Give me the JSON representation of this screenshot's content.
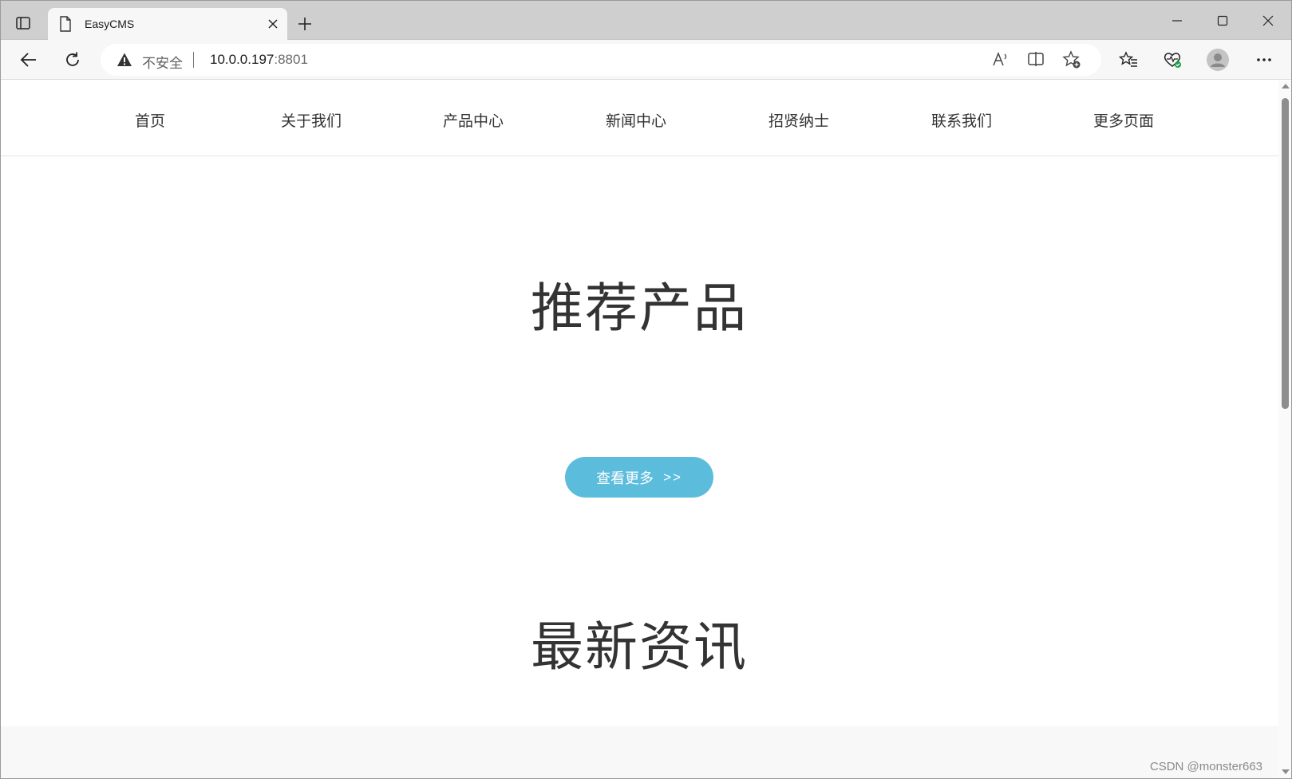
{
  "browser": {
    "tab": {
      "title": "EasyCMS"
    },
    "address_bar": {
      "security_label": "不安全",
      "url_host": "10.0.0.197",
      "url_port": ":8801"
    },
    "icons": {
      "read_aloud": "A⁾"
    }
  },
  "site": {
    "nav": [
      {
        "label": "首页"
      },
      {
        "label": "关于我们"
      },
      {
        "label": "产品中心"
      },
      {
        "label": "新闻中心"
      },
      {
        "label": "招贤纳士"
      },
      {
        "label": "联系我们"
      },
      {
        "label": "更多页面"
      }
    ],
    "sections": {
      "products_title": "推荐产品",
      "more_button_label": "查看更多",
      "more_button_arrows": ">>",
      "news_title": "最新资讯"
    },
    "watermark": "CSDN @monster663"
  },
  "colors": {
    "accent_button": "#5bbcdc",
    "titlebar": "#cfcfcf",
    "toolbar": "#f7f7f7"
  }
}
